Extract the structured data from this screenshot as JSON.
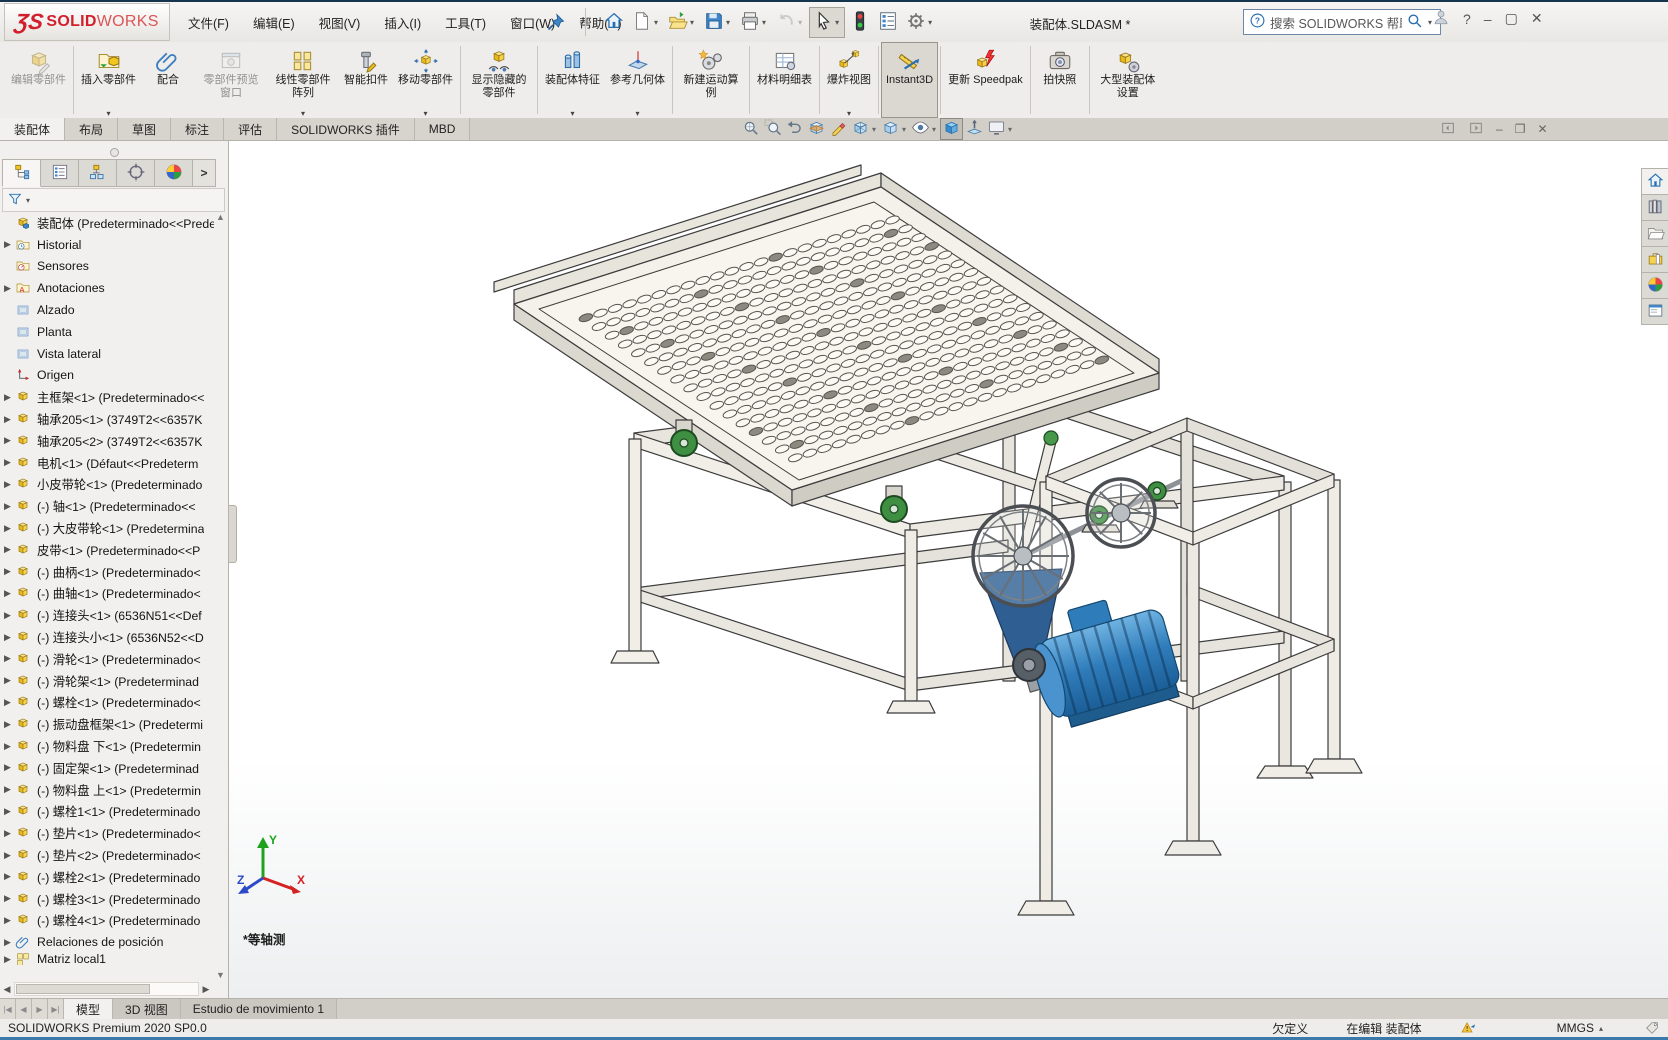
{
  "colors": {
    "accent_blue": "#2a6fb0",
    "brand_red": "#d21f2c",
    "motor_blue": "#2f7cba",
    "wheel_green": "#3f8f43",
    "statusbar_edge": "#3b79ab"
  },
  "titlebar": {
    "logo_text": "SOLIDWORKS",
    "logo_bold": "SOLID",
    "logo_light": "WORKS",
    "menus": [
      {
        "name": "file",
        "label": "文件(F)"
      },
      {
        "name": "edit",
        "label": "编辑(E)"
      },
      {
        "name": "view",
        "label": "视图(V)"
      },
      {
        "name": "insert",
        "label": "插入(I)"
      },
      {
        "name": "tools",
        "label": "工具(T)"
      },
      {
        "name": "window",
        "label": "窗口(W)"
      },
      {
        "name": "help",
        "label": "帮助(H)"
      }
    ],
    "document_title": "装配体.SLDASM *",
    "search_placeholder": "搜索 SOLIDWORKS 帮助",
    "quick_access": [
      {
        "name": "home",
        "icon": "home-icon"
      },
      {
        "name": "new-document",
        "icon": "new-doc-icon",
        "dropdown": true
      },
      {
        "name": "open",
        "icon": "open-icon",
        "dropdown": true
      },
      {
        "name": "save",
        "icon": "save-icon",
        "dropdown": true
      },
      {
        "name": "print",
        "icon": "print-icon",
        "dropdown": true
      },
      {
        "name": "undo",
        "icon": "undo-icon",
        "dropdown": true,
        "disabled": true
      },
      {
        "name": "select",
        "icon": "select-cursor-icon",
        "dropdown": true,
        "pressed": true
      },
      {
        "name": "rebuild",
        "icon": "rebuild-traffic-icon"
      },
      {
        "name": "options-list",
        "icon": "bom-list-icon"
      },
      {
        "name": "settings",
        "icon": "gear-icon",
        "dropdown": true
      }
    ],
    "window_buttons": {
      "help": "?",
      "minimize": "–",
      "maximize": "▢",
      "close": "✕"
    }
  },
  "ribbon": {
    "buttons": [
      {
        "id": "edit-component",
        "label": "编辑零部件",
        "icon": "edit-part-icon",
        "disabled": true,
        "sep": true
      },
      {
        "id": "insert-components",
        "label": "插入零部件",
        "icon": "insert-part-icon",
        "dropdown": true
      },
      {
        "id": "mate",
        "label": "配合",
        "icon": "mate-icon"
      },
      {
        "id": "component-preview-window",
        "label": "零部件预览窗口",
        "icon": "preview-window-icon",
        "disabled": true
      },
      {
        "id": "linear-component-pattern",
        "label": "线性零部件阵列",
        "icon": "linear-pattern-icon",
        "dropdown": true
      },
      {
        "id": "smart-fasteners",
        "label": "智能扣件",
        "icon": "smart-fastener-icon"
      },
      {
        "id": "move-component",
        "label": "移动零部件",
        "icon": "move-component-icon",
        "dropdown": true,
        "sep": true
      },
      {
        "id": "show-hidden-components",
        "label": "显示隐藏的零部件",
        "icon": "show-hidden-icon",
        "sep": true
      },
      {
        "id": "assembly-features",
        "label": "装配体特征",
        "icon": "assembly-features-icon",
        "dropdown": true
      },
      {
        "id": "reference-geometry",
        "label": "参考几何体",
        "icon": "reference-geometry-icon",
        "dropdown": true,
        "sep": true
      },
      {
        "id": "new-motion-study",
        "label": "新建运动算例",
        "icon": "motion-study-icon",
        "sep": true
      },
      {
        "id": "bill-of-materials",
        "label": "材料明细表",
        "icon": "bom-icon",
        "sep": true
      },
      {
        "id": "exploded-view",
        "label": "爆炸视图",
        "icon": "exploded-view-icon",
        "dropdown": true,
        "sep": true
      },
      {
        "id": "instant3d",
        "label": "Instant3D",
        "icon": "instant3d-icon",
        "active": true,
        "wide": true,
        "sep": true
      },
      {
        "id": "update-speedpak",
        "label": "更新 Speedpak",
        "icon": "update-speedpak-icon",
        "wide": true,
        "sep": true
      },
      {
        "id": "take-snapshot",
        "label": "拍快照",
        "icon": "snapshot-icon",
        "sep": true
      },
      {
        "id": "large-assembly-settings",
        "label": "大型装配体设置",
        "icon": "large-assembly-icon"
      }
    ],
    "tabs": [
      {
        "name": "assembly",
        "label": "装配体",
        "active": true
      },
      {
        "name": "layout",
        "label": "布局"
      },
      {
        "name": "sketch",
        "label": "草图"
      },
      {
        "name": "markup",
        "label": "标注"
      },
      {
        "name": "evaluate",
        "label": "评估"
      },
      {
        "name": "addins",
        "label": "SOLIDWORKS 插件"
      },
      {
        "name": "mbd",
        "label": "MBD"
      }
    ]
  },
  "headsup": [
    {
      "name": "zoom-to-fit",
      "icon": "zoom-fit-icon"
    },
    {
      "name": "zoom-to-area",
      "icon": "zoom-area-icon"
    },
    {
      "name": "previous-view",
      "icon": "previous-view-icon"
    },
    {
      "name": "section-view",
      "icon": "section-view-icon"
    },
    {
      "name": "annotation-views",
      "icon": "annotation-views-icon"
    },
    {
      "name": "view-orientation",
      "icon": "view-orientation-icon",
      "dropdown": true
    },
    {
      "name": "display-style",
      "icon": "display-style-icon",
      "dropdown": true
    },
    {
      "name": "hide-show-items",
      "icon": "hide-show-icon",
      "dropdown": true
    },
    {
      "name": "edit-appearance",
      "icon": "edit-appearance-icon",
      "pressed": true
    },
    {
      "name": "apply-scene",
      "icon": "apply-scene-icon"
    },
    {
      "name": "view-settings",
      "icon": "view-settings-icon",
      "dropdown": true
    }
  ],
  "panel_tabs": [
    {
      "name": "featuremanager",
      "icon": "featuremanager-icon",
      "active": true
    },
    {
      "name": "propertymanager",
      "icon": "propertymanager-icon"
    },
    {
      "name": "configurationmanager",
      "icon": "configurationmanager-icon"
    },
    {
      "name": "dimxpertmanager",
      "icon": "dimxpert-icon"
    },
    {
      "name": "displaymanager",
      "icon": "displaymanager-icon"
    },
    {
      "name": "expand-chevron",
      "label": ">",
      "chev": true
    }
  ],
  "feature_tree": {
    "root": {
      "icon": "asm-root-icon",
      "label": "装配体 (Predeterminado<<Predet"
    },
    "items": [
      {
        "icon": "history-folder-icon",
        "arrow": true,
        "label": "Historial"
      },
      {
        "icon": "sensors-folder-icon",
        "label": "Sensores"
      },
      {
        "icon": "annotations-folder-icon",
        "arrow": true,
        "label": "Anotaciones"
      },
      {
        "icon": "plane-icon",
        "label": "Alzado"
      },
      {
        "icon": "plane-icon",
        "label": "Planta"
      },
      {
        "icon": "plane-icon",
        "label": "Vista lateral"
      },
      {
        "icon": "origin-icon",
        "label": "Origen"
      },
      {
        "icon": "part-icon",
        "arrow": true,
        "label": "主框架<1> (Predeterminado<<"
      },
      {
        "icon": "part-icon",
        "arrow": true,
        "label": "轴承205<1> (3749T2<<6357K"
      },
      {
        "icon": "part-icon",
        "arrow": true,
        "label": "轴承205<2> (3749T2<<6357K"
      },
      {
        "icon": "part-icon",
        "arrow": true,
        "label": "电机<1> (Défaut<<Predeterm"
      },
      {
        "icon": "part-icon",
        "arrow": true,
        "label": "小皮带轮<1> (Predeterminado"
      },
      {
        "icon": "part-icon",
        "arrow": true,
        "label": "(-) 轴<1> (Predeterminado<<"
      },
      {
        "icon": "part-icon",
        "arrow": true,
        "label": "(-) 大皮带轮<1> (Predetermina"
      },
      {
        "icon": "part-icon",
        "arrow": true,
        "label": "皮带<1> (Predeterminado<<P"
      },
      {
        "icon": "part-icon",
        "arrow": true,
        "label": "(-) 曲柄<1> (Predeterminado<"
      },
      {
        "icon": "part-icon",
        "arrow": true,
        "label": "(-) 曲轴<1> (Predeterminado<"
      },
      {
        "icon": "part-icon",
        "arrow": true,
        "label": "(-) 连接头<1> (6536N51<<Def"
      },
      {
        "icon": "part-icon",
        "arrow": true,
        "label": "(-) 连接头小<1> (6536N52<<D"
      },
      {
        "icon": "part-icon",
        "arrow": true,
        "label": "(-) 滑轮<1> (Predeterminado<"
      },
      {
        "icon": "part-icon",
        "arrow": true,
        "label": "(-) 滑轮架<1> (Predeterminad"
      },
      {
        "icon": "part-icon",
        "arrow": true,
        "label": "(-) 螺栓<1> (Predeterminado<"
      },
      {
        "icon": "part-icon",
        "arrow": true,
        "label": "(-) 振动盘框架<1> (Predetermi"
      },
      {
        "icon": "part-icon",
        "arrow": true,
        "label": "(-) 物料盘 下<1> (Predetermin"
      },
      {
        "icon": "part-icon",
        "arrow": true,
        "label": "(-) 固定架<1> (Predeterminad"
      },
      {
        "icon": "part-icon",
        "arrow": true,
        "label": "(-) 物料盘 上<1> (Predetermin"
      },
      {
        "icon": "part-icon",
        "arrow": true,
        "label": "(-) 螺栓1<1> (Predeterminado"
      },
      {
        "icon": "part-icon",
        "arrow": true,
        "label": "(-) 垫片<1> (Predeterminado<"
      },
      {
        "icon": "part-icon",
        "arrow": true,
        "label": "(-) 垫片<2> (Predeterminado<"
      },
      {
        "icon": "part-icon",
        "arrow": true,
        "label": "(-) 螺栓2<1> (Predeterminado"
      },
      {
        "icon": "part-icon",
        "arrow": true,
        "label": "(-) 螺栓3<1> (Predeterminado"
      },
      {
        "icon": "part-icon",
        "arrow": true,
        "label": "(-) 螺栓4<1> (Predeterminado"
      },
      {
        "icon": "mates-icon",
        "arrow": true,
        "label": "Relaciones de posición"
      },
      {
        "icon": "pattern-icon",
        "arrow": true,
        "label": "Matriz local1",
        "partial": true
      }
    ]
  },
  "taskpane": [
    {
      "name": "home",
      "icon": "home-icon",
      "active": true
    },
    {
      "name": "design-library",
      "icon": "books-icon"
    },
    {
      "name": "file-explorer",
      "icon": "folder-tp-icon"
    },
    {
      "name": "toolbox",
      "icon": "toolbox-icon"
    },
    {
      "name": "appearances",
      "icon": "displaymanager-icon"
    },
    {
      "name": "custom-properties",
      "icon": "panel-win-icon"
    }
  ],
  "viewport": {
    "view_label": "*等轴测",
    "triad_labels": {
      "x": "X",
      "y": "Y",
      "z": "Z"
    }
  },
  "bottom_tabs": {
    "nav": [
      "first",
      "previous",
      "next",
      "last"
    ],
    "tabs": [
      {
        "name": "model",
        "label": "模型",
        "active": true
      },
      {
        "name": "3d-views",
        "label": "3D 视图"
      },
      {
        "name": "motion-study-1",
        "label": "Estudio de movimiento 1"
      }
    ]
  },
  "statusbar": {
    "left": "SOLIDWORKS Premium 2020 SP0.0",
    "definition": "欠定义",
    "editing": "在编辑 装配体",
    "units": "MMGS"
  }
}
